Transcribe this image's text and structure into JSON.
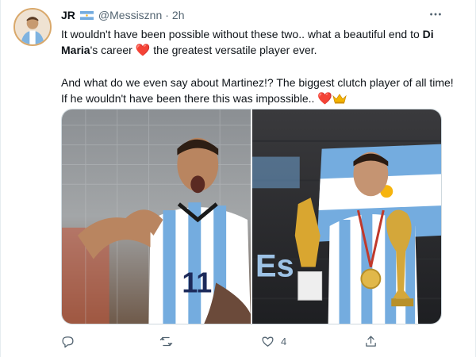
{
  "tweet": {
    "author_name": "JR",
    "author_handle": "@Messisznn",
    "separator": "·",
    "time": "2h",
    "paragraph1": {
      "part1": "It wouldn't have been possible without these two.. what a beautiful end to ",
      "bold": "Di Maria",
      "part2": "'s career ",
      "emoji_heart": "❤️",
      "part3": " the greatest versatile player ever."
    },
    "paragraph2": {
      "part1": "And what do we even say about Martinez!? The biggest clutch player of all time! If he wouldn't have been there this was impossible.. ",
      "emoji_heart": "❤️",
      "emoji_crown": "crown-emoji"
    },
    "media": {
      "photo1": {
        "jersey_number": "11"
      },
      "photo2": {
        "banner_text": "Es"
      }
    },
    "actions": {
      "reply_count": "",
      "retweet_count": "",
      "like_count": "4",
      "share_count": ""
    }
  },
  "colors": {
    "text_primary": "#0f1419",
    "text_secondary": "#536471",
    "heart": "#e0245e",
    "border": "#cfd9de",
    "argentina_blue": "#74acdf"
  },
  "icons": {
    "more": "more-icon",
    "reply": "reply-icon",
    "retweet": "retweet-icon",
    "like": "heart-icon",
    "share": "share-icon",
    "flag": "argentina-flag-icon"
  }
}
